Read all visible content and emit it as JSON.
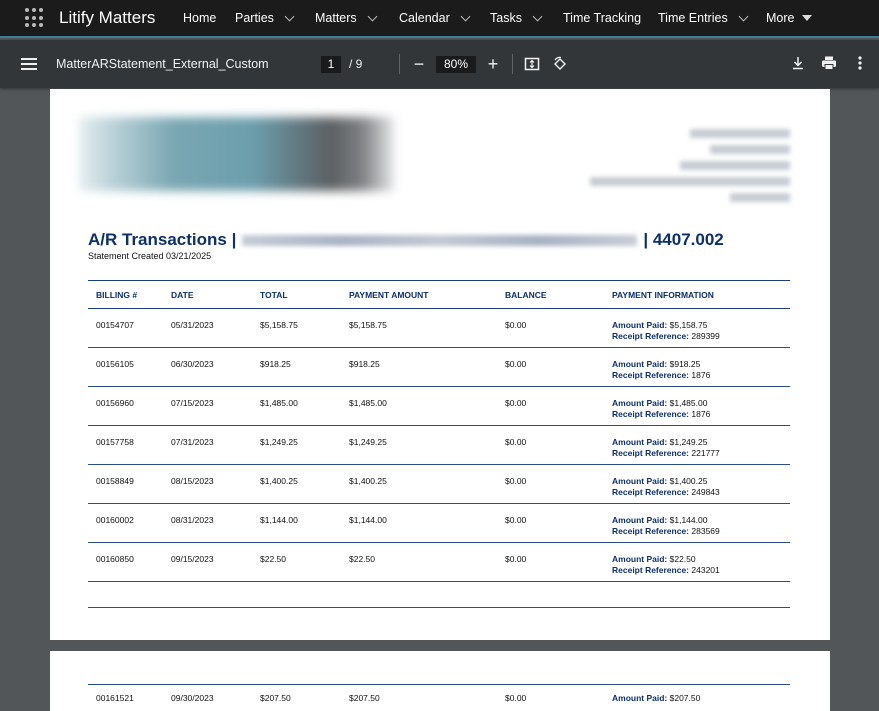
{
  "app": {
    "name": "Litify Matters",
    "nav": [
      {
        "label": "Home",
        "dropdown": false
      },
      {
        "label": "Parties",
        "dropdown": true
      },
      {
        "label": "Matters",
        "dropdown": true
      },
      {
        "label": "Calendar",
        "dropdown": true
      },
      {
        "label": "Tasks",
        "dropdown": true
      },
      {
        "label": "Time Tracking",
        "dropdown": false
      },
      {
        "label": "Time Entries",
        "dropdown": true
      },
      {
        "label": "More",
        "dropdown": true
      }
    ]
  },
  "viewer": {
    "doc_name": "MatterARStatement_External_Custom",
    "current_page": "1",
    "page_total": "/  9",
    "zoom": "80%",
    "icons": [
      "menu-icon",
      "zoom-out-icon",
      "zoom-in-icon",
      "fit-page-icon",
      "rotate-icon",
      "download-icon",
      "print-icon",
      "more-options-icon"
    ]
  },
  "statement": {
    "title_prefix": "A/R Transactions |",
    "title_suffix": "| 4407.002",
    "created": "Statement Created 03/21/2025",
    "columns": [
      "BILLING #",
      "DATE",
      "TOTAL",
      "PAYMENT AMOUNT",
      "BALANCE",
      "PAYMENT INFORMATION"
    ],
    "amount_paid_label": "Amount Paid:",
    "receipt_label": "Receipt Reference:",
    "rows": [
      {
        "billing": "00154707",
        "date": "05/31/2023",
        "total": "$5,158.75",
        "payment": "$5,158.75",
        "balance": "$0.00",
        "paid": "$5,158.75",
        "receipt": "289399"
      },
      {
        "billing": "00156105",
        "date": "06/30/2023",
        "total": "$918.25",
        "payment": "$918.25",
        "balance": "$0.00",
        "paid": "$918.25",
        "receipt": "1876"
      },
      {
        "billing": "00156960",
        "date": "07/15/2023",
        "total": "$1,485.00",
        "payment": "$1,485.00",
        "balance": "$0.00",
        "paid": "$1,485.00",
        "receipt": "1876"
      },
      {
        "billing": "00157758",
        "date": "07/31/2023",
        "total": "$1,249.25",
        "payment": "$1,249.25",
        "balance": "$0.00",
        "paid": "$1,249.25",
        "receipt": "221777"
      },
      {
        "billing": "00158849",
        "date": "08/15/2023",
        "total": "$1,400.25",
        "payment": "$1,400.25",
        "balance": "$0.00",
        "paid": "$1,400.25",
        "receipt": "249843"
      },
      {
        "billing": "00160002",
        "date": "08/31/2023",
        "total": "$1,144.00",
        "payment": "$1,144.00",
        "balance": "$0.00",
        "paid": "$1,144.00",
        "receipt": "283569"
      },
      {
        "billing": "00160850",
        "date": "09/15/2023",
        "total": "$22.50",
        "payment": "$22.50",
        "balance": "$0.00",
        "paid": "$22.50",
        "receipt": "243201"
      }
    ],
    "page2_row": {
      "billing": "00161521",
      "date": "09/30/2023",
      "total": "$207.50",
      "payment": "$207.50",
      "balance": "$0.00",
      "paid": "$207.50"
    }
  },
  "colors": {
    "appbar": "#1b1b1b",
    "toolbar": "#323639",
    "viewer_bg": "#525659",
    "accent": "#3f7e99",
    "statement_blue": "#0d2f6a"
  }
}
